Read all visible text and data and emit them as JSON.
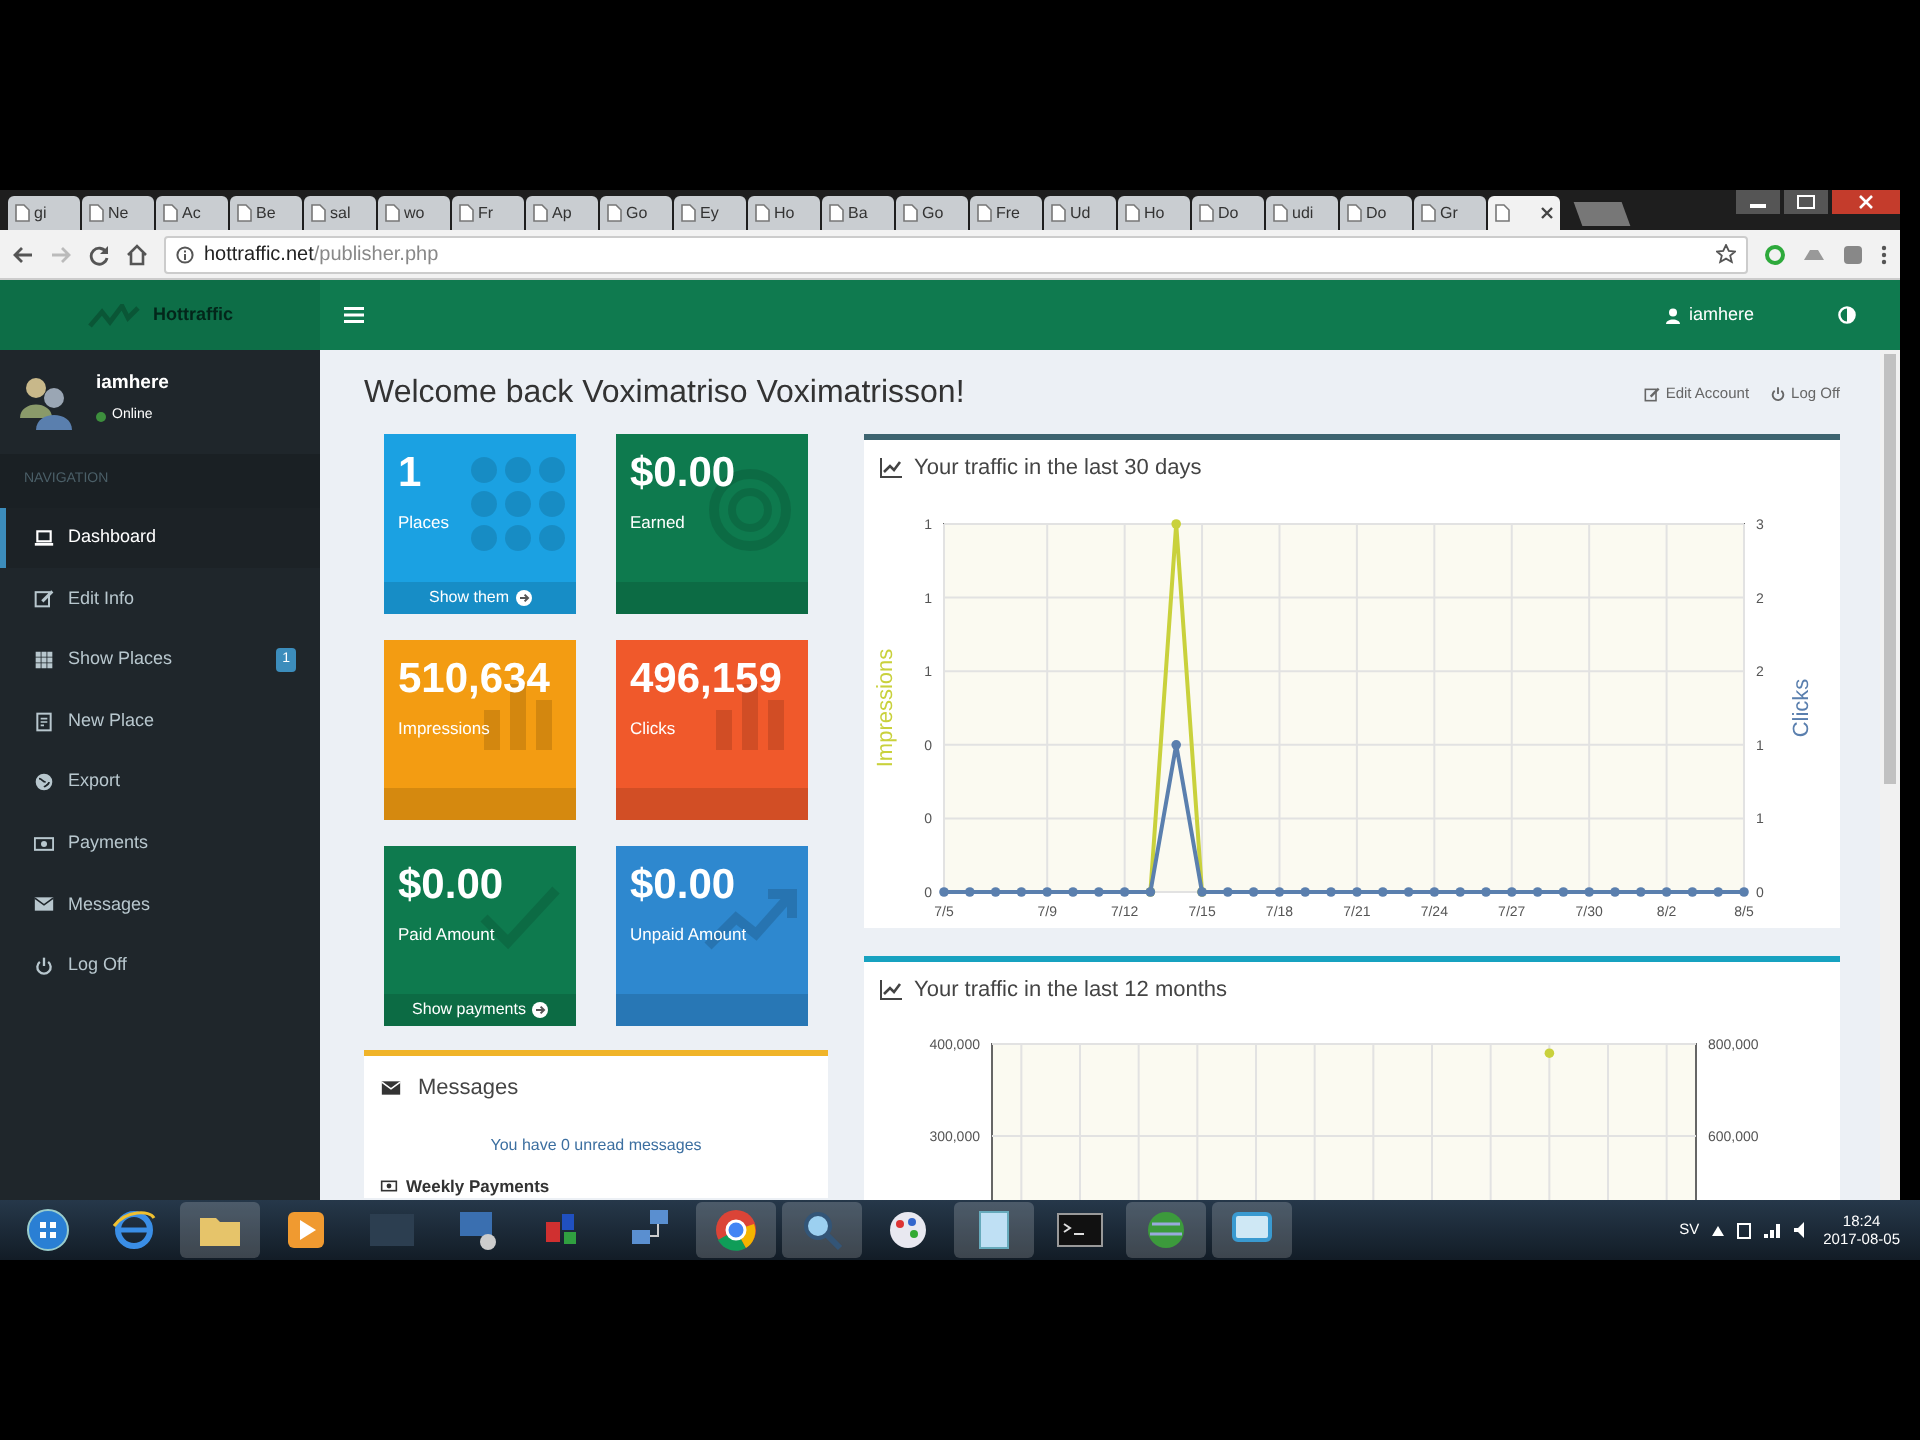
{
  "browser": {
    "tabs": [
      {
        "label": "gi",
        "selected": false
      },
      {
        "label": "Ne",
        "selected": false
      },
      {
        "label": "Ac",
        "selected": false
      },
      {
        "label": "Be",
        "selected": false
      },
      {
        "label": "sal",
        "selected": false
      },
      {
        "label": "wo",
        "selected": false
      },
      {
        "label": "Fr",
        "selected": false
      },
      {
        "label": "Ap",
        "selected": false
      },
      {
        "label": "Go",
        "selected": false
      },
      {
        "label": "Ey",
        "selected": false
      },
      {
        "label": "Ho",
        "selected": false
      },
      {
        "label": "Ba",
        "selected": false
      },
      {
        "label": "Go",
        "selected": false
      },
      {
        "label": "Fre",
        "selected": false
      },
      {
        "label": "Ud",
        "selected": false
      },
      {
        "label": "Ho",
        "selected": false
      },
      {
        "label": "Do",
        "selected": false
      },
      {
        "label": "udi",
        "selected": false
      },
      {
        "label": "Do",
        "selected": false
      },
      {
        "label": "Gr",
        "selected": false
      },
      {
        "selected": true
      }
    ],
    "address": {
      "host": "hottraffic.net",
      "path": "/publisher.php"
    }
  },
  "header": {
    "logo": "Hottraffic",
    "user": "iamhere"
  },
  "sidebar": {
    "user": "iamhere",
    "status": "Online",
    "heading": "NAVIGATION",
    "items": [
      {
        "label": "Dashboard",
        "selected": true
      },
      {
        "label": "Edit Info",
        "selected": false
      },
      {
        "label": "Show Places",
        "selected": false,
        "badge": "1"
      },
      {
        "label": "New Place",
        "selected": false
      },
      {
        "label": "Export",
        "selected": false
      },
      {
        "label": "Payments",
        "selected": false
      },
      {
        "label": "Messages",
        "selected": false
      },
      {
        "label": "Log Off",
        "selected": false
      }
    ]
  },
  "page": {
    "title": "Welcome back Voximatriso Voximatrisson!",
    "links": [
      "Edit Account",
      "Log Off"
    ]
  },
  "tiles": [
    {
      "value": "1",
      "label": "Places",
      "footer": "Show them",
      "color": "#1ba1e2"
    },
    {
      "value": "$0.00",
      "label": "Earned",
      "color": "#0e7a4e"
    },
    {
      "value": "510,634",
      "label": "Impressions",
      "color": "#f39c12"
    },
    {
      "value": "496,159",
      "label": "Clicks",
      "color": "#f0592b"
    },
    {
      "value": "$0.00",
      "label": "Paid Amount",
      "footer": "Show payments",
      "color": "#0e7a4e"
    },
    {
      "value": "$0.00",
      "label": "Unpaid Amount",
      "color": "#2e88cf"
    }
  ],
  "messages": {
    "title": "Messages",
    "text": "You have 0 unread messages"
  },
  "payments": {
    "title": "Weekly Payments"
  },
  "charts": [
    {
      "title": "Your traffic in the last 30 days",
      "chart_data": {
        "type": "line",
        "grid": true,
        "categories": [
          "7/5",
          null,
          null,
          null,
          "7/9",
          null,
          null,
          "7/12",
          null,
          null,
          "7/15",
          null,
          null,
          "7/18",
          null,
          null,
          "7/21",
          null,
          null,
          "7/24",
          null,
          null,
          "7/27",
          null,
          null,
          "7/30",
          null,
          null,
          "8/2",
          null,
          null,
          "8/5"
        ],
        "ylim": [
          0,
          1
        ],
        "yticks": [
          {
            "value": 0,
            "label": "0"
          },
          {
            "value": 0.2,
            "label": "0"
          },
          {
            "value": 0.4,
            "label": "0"
          },
          {
            "value": 0.6,
            "label": "1"
          },
          {
            "value": 0.8,
            "label": "1"
          },
          {
            "value": 1,
            "label": "1"
          }
        ],
        "y2lim": [
          0,
          2.5
        ],
        "y2ticks": [
          {
            "value": 0,
            "label": "0"
          },
          {
            "value": 0.5,
            "label": "1"
          },
          {
            "value": 1,
            "label": "1"
          },
          {
            "value": 1.5,
            "label": "2"
          },
          {
            "value": 2,
            "label": "2"
          },
          {
            "value": 2.5,
            "label": "3"
          }
        ],
        "series": [
          {
            "name": "Impressions",
            "color": "#c9d13c",
            "marker": true,
            "values": [
              null,
              null,
              null,
              null,
              null,
              null,
              null,
              null,
              0,
              1,
              0,
              null,
              null,
              null,
              null,
              null,
              null,
              null,
              null,
              null,
              null,
              null,
              null,
              null,
              null,
              null,
              null,
              null,
              null,
              null,
              null,
              null
            ]
          },
          {
            "name": "Clicks",
            "color": "#5a7fae",
            "axis": "y2",
            "marker": true,
            "values": [
              0,
              0,
              0,
              0,
              0,
              0,
              0,
              0,
              0,
              1,
              0,
              0,
              0,
              0,
              0,
              0,
              0,
              0,
              0,
              0,
              0,
              0,
              0,
              0,
              0,
              0,
              0,
              0,
              0,
              0,
              0,
              0
            ]
          }
        ]
      }
    },
    {
      "title": "Your traffic in the last 12 months",
      "chart_data": {
        "type": "line",
        "grid": true,
        "ylim": [
          0,
          400000
        ],
        "yticks": [
          {
            "value": 400000,
            "label": "400,000"
          },
          {
            "value": 300000,
            "label": "300,000"
          }
        ],
        "y2lim": [
          0,
          800000
        ],
        "y2ticks": [
          {
            "value": 800000,
            "label": "800,000"
          },
          {
            "value": 600000,
            "label": "600,000"
          }
        ],
        "series": [
          {
            "color": "#c9d13c",
            "marker": true,
            "values": [
              null,
              null,
              null,
              null,
              null,
              null,
              null,
              null,
              null,
              390000,
              null,
              null
            ]
          }
        ]
      }
    }
  ],
  "taskbar": {
    "language": "SV",
    "time": "18:24",
    "date": "2017-08-05"
  }
}
